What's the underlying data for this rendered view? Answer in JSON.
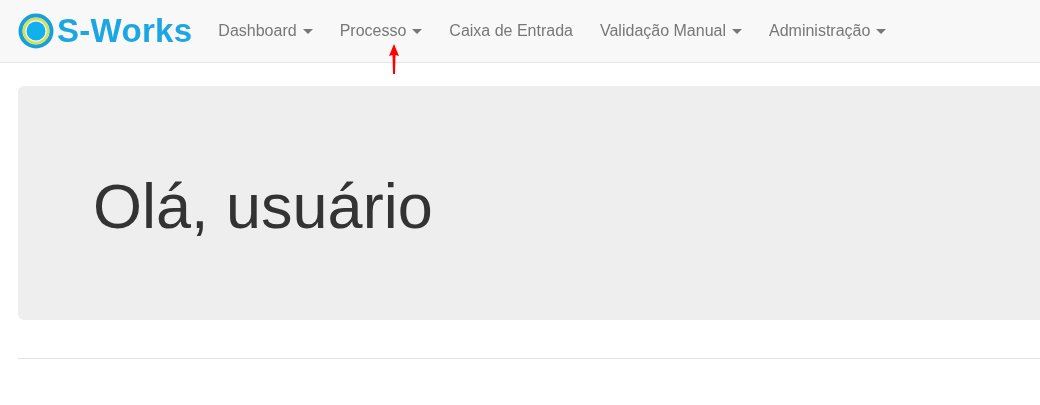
{
  "brand": {
    "name": "S-Works"
  },
  "nav": [
    {
      "label": "Dashboard",
      "dropdown": true
    },
    {
      "label": "Processo",
      "dropdown": true
    },
    {
      "label": "Caixa de Entrada",
      "dropdown": false
    },
    {
      "label": "Validação Manual",
      "dropdown": true
    },
    {
      "label": "Administração",
      "dropdown": true
    }
  ],
  "hero": {
    "title": "Olá, usuário"
  }
}
